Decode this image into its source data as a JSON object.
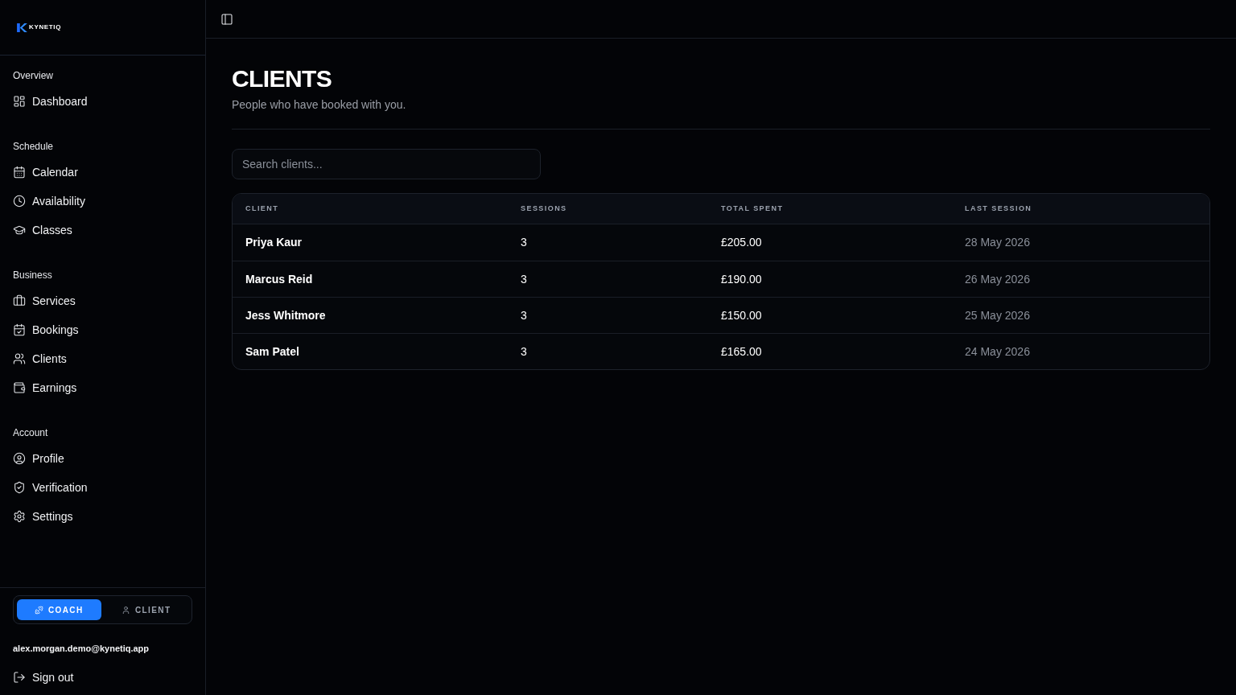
{
  "sidebar": {
    "brand": "KYNETIQ",
    "sections": [
      {
        "title": "Overview",
        "items": [
          {
            "label": "Dashboard"
          }
        ]
      },
      {
        "title": "Schedule",
        "items": [
          {
            "label": "Calendar"
          },
          {
            "label": "Availability"
          },
          {
            "label": "Classes"
          }
        ]
      },
      {
        "title": "Business",
        "items": [
          {
            "label": "Services"
          },
          {
            "label": "Bookings"
          },
          {
            "label": "Clients"
          },
          {
            "label": "Earnings"
          }
        ]
      },
      {
        "title": "Account",
        "items": [
          {
            "label": "Profile"
          },
          {
            "label": "Verification"
          },
          {
            "label": "Settings"
          }
        ]
      }
    ],
    "role_switch": [
      {
        "label": "COACH",
        "selected": true
      },
      {
        "label": "CLIENT",
        "selected": false
      }
    ],
    "user_email": "alex.morgan.demo@kynetiq.app",
    "sign_out": "Sign out"
  },
  "page": {
    "title": "CLIENTS",
    "subtitle": "People who have booked with you.",
    "search": {
      "placeholder": "Search clients..."
    },
    "table": {
      "columns": [
        "CLIENT",
        "SESSIONS",
        "TOTAL SPENT",
        "LAST SESSION"
      ],
      "rows": [
        {
          "cells": [
            "Priya Kaur",
            "3",
            "£205.00",
            "28 May 2026"
          ]
        },
        {
          "cells": [
            "Marcus Reid",
            "3",
            "£190.00",
            "26 May 2026"
          ]
        },
        {
          "cells": [
            "Jess Whitmore",
            "3",
            "£150.00",
            "25 May 2026"
          ]
        },
        {
          "cells": [
            "Sam Patel",
            "3",
            "£165.00",
            "24 May 2026"
          ]
        }
      ]
    }
  }
}
